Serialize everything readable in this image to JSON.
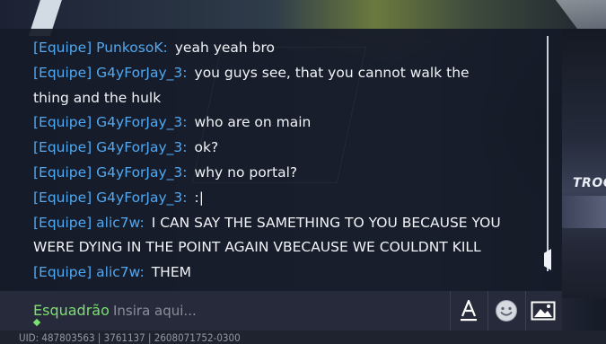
{
  "background": {
    "side_label": "TROCA"
  },
  "chat": {
    "messages": [
      {
        "sender": "[Equipe] PunkosoK",
        "text": "yeah yeah bro"
      },
      {
        "sender": "[Equipe] G4yForJay_3",
        "text": "you guys see, that you cannot walk the thing and the hulk"
      },
      {
        "sender": "[Equipe] G4yForJay_3",
        "text": "who are on main"
      },
      {
        "sender": "[Equipe] G4yForJay_3",
        "text": "ok?"
      },
      {
        "sender": "[Equipe] G4yForJay_3",
        "text": "why no portal?"
      },
      {
        "sender": "[Equipe] G4yForJay_3",
        "text": ":|"
      },
      {
        "sender": "[Equipe] alic7w",
        "text": "I CAN SAY THE SAMETHING TO YOU BECAUSE YOU WERE DYING IN THE POINT AGAIN VBECAUSE WE COULDNT KILL"
      },
      {
        "sender": "[Equipe] alic7w",
        "text": "THEM"
      }
    ],
    "separator": ":"
  },
  "input_bar": {
    "channel": "Esquadrão",
    "placeholder": "Insira aqui...",
    "value": "",
    "icons": [
      "text-format-icon",
      "emoji-icon",
      "image-icon"
    ]
  },
  "footer": {
    "uid": "UID: 487803563 | 3761137 | 2608071752-0300"
  },
  "colors": {
    "sender": "#52a8f0",
    "message_text": "#f1f3f7",
    "channel": "#7be06f",
    "placeholder": "#8a8f9c"
  }
}
